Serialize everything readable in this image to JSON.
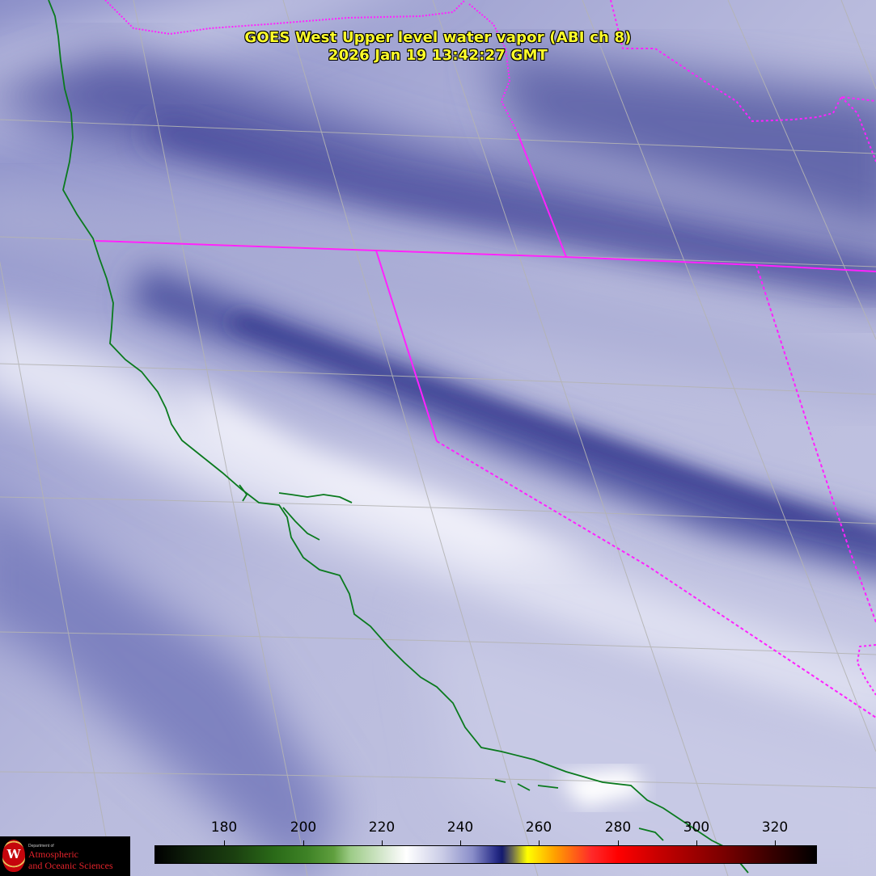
{
  "title": {
    "line1": "GOES West Upper level water vapor (ABI ch 8)",
    "line2": "2026 Jan 19  13:42:27 GMT"
  },
  "colorbar": {
    "ticks": [
      "180",
      "200",
      "220",
      "240",
      "260",
      "280",
      "300",
      "320"
    ]
  },
  "logo": {
    "letter": "W",
    "department": "Department of",
    "line1": "Atmospheric",
    "line2": "and Oceanic Sciences"
  },
  "map_layers": [
    "water-vapor-imagery",
    "lat-lon-grid",
    "coastline",
    "state-borders"
  ],
  "colors": {
    "title": "#ffff2a",
    "coastline": "#0a7a1e",
    "borders": "#ff22ff",
    "grid": "#b4b4b4"
  }
}
